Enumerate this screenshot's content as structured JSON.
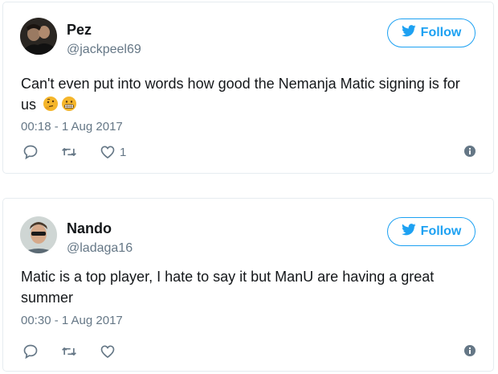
{
  "colors": {
    "accent": "#1da1f2",
    "secondary_text": "#657786",
    "primary_text": "#14171a",
    "border": "#e6ecf0"
  },
  "tweets": [
    {
      "display_name": "Pez",
      "handle": "@jackpeel69",
      "follow_label": "Follow",
      "text": "Can't even put into words how good the Nemanja Matic signing is for us",
      "emojis": [
        "thinking-face-emoji",
        "grimacing-face-emoji"
      ],
      "timestamp": "00:18 - 1 Aug 2017",
      "like_count": "1",
      "icons": [
        "reply-icon",
        "retweet-icon",
        "like-icon",
        "info-icon"
      ]
    },
    {
      "display_name": "Nando",
      "handle": "@ladaga16",
      "follow_label": "Follow",
      "text": "Matic is a top player, I hate to say it but ManU are having a great summer",
      "emojis": [],
      "timestamp": "00:30 - 1 Aug 2017",
      "like_count": "",
      "icons": [
        "reply-icon",
        "retweet-icon",
        "like-icon",
        "info-icon"
      ]
    }
  ]
}
